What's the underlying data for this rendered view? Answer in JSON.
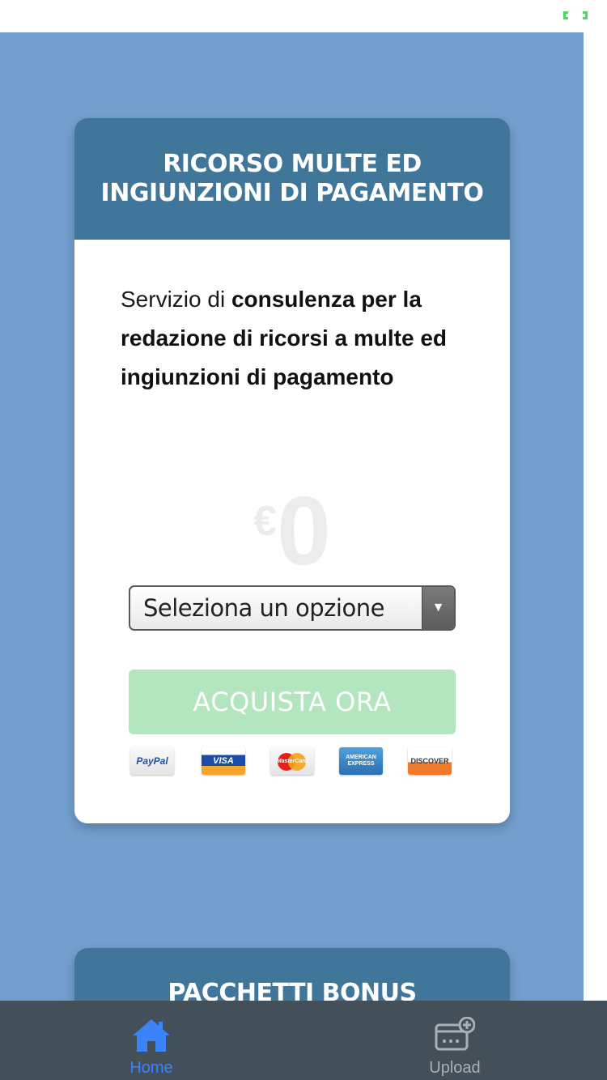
{
  "colors": {
    "page_background": "#739fcf",
    "card_header": "#3f7699",
    "buy_button": "#b3e6bf",
    "tabbar": "#43505a",
    "tab_active": "#3b83f6",
    "tab_inactive": "#a9b0b6"
  },
  "status_bar": {
    "icon": "battery-icon"
  },
  "product_card": {
    "title": "RICORSO MULTE ED INGIUNZIONI DI PAGAMENTO",
    "description_intro": "Servizio di ",
    "description_bold": "consulenza per la redazione di ricorsi a multe ed ingiunzioni di pagamento",
    "price_currency": "€",
    "price_value": "0",
    "select_placeholder": "Seleziona un opzione",
    "buy_button_label": "ACQUISTA ORA",
    "payment_methods": [
      {
        "name": "PayPal",
        "icon": "paypal-icon",
        "label": "PayPal"
      },
      {
        "name": "Visa",
        "icon": "visa-icon",
        "label": "VISA"
      },
      {
        "name": "MasterCard",
        "icon": "mastercard-icon",
        "label": "MasterCard"
      },
      {
        "name": "American Express",
        "icon": "amex-icon",
        "label": "AMERICAN EXPRESS"
      },
      {
        "name": "Discover",
        "icon": "discover-icon",
        "label": "DISCOVER"
      }
    ]
  },
  "bonus_card": {
    "title": "PACCHETTI BONUS"
  },
  "tabbar": {
    "tabs": [
      {
        "label": "Home",
        "icon": "home-icon",
        "active": true
      },
      {
        "label": "Upload",
        "icon": "upload-icon",
        "active": false
      }
    ]
  }
}
